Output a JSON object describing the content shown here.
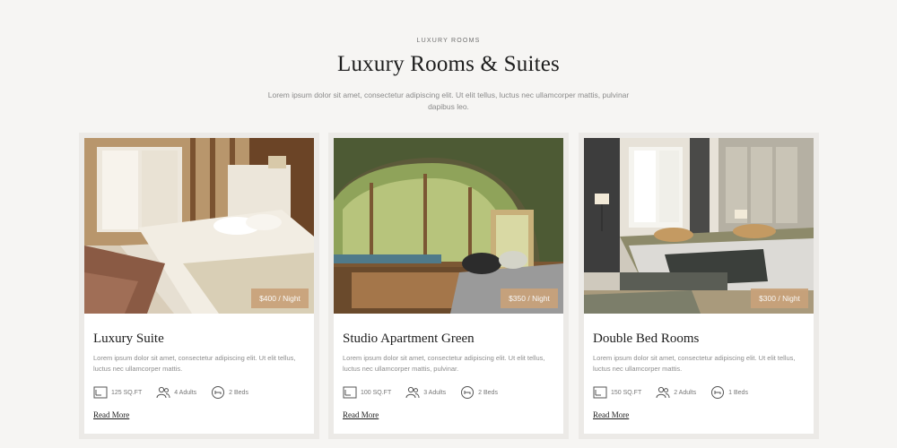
{
  "section": {
    "eyebrow": "LUXURY ROOMS",
    "title": "Luxury Rooms & Suites",
    "intro": "Lorem ipsum dolor sit amet, consectetur adipiscing elit. Ut elit tellus, luctus nec ullamcorper mattis, pulvinar dapibus leo."
  },
  "rooms": [
    {
      "title": "Luxury Suite",
      "price": "$400 / Night",
      "description": "Lorem ipsum dolor sit amet, consectetur adipiscing elit. Ut elit tellus, luctus nec ullamcorper mattis.",
      "size": "125 SQ.FT",
      "guests": "4 Adults",
      "beds": "2 Beds",
      "read_more": "Read More"
    },
    {
      "title": "Studio Apartment Green",
      "price": "$350 / Night",
      "description": "Lorem ipsum dolor sit amet, consectetur adipiscing elit. Ut elit tellus, luctus nec ullamcorper mattis, pulvinar.",
      "size": "100 SQ.FT",
      "guests": "3 Adults",
      "beds": "2 Beds",
      "read_more": "Read More"
    },
    {
      "title": "Double Bed Rooms",
      "price": "$300 / Night",
      "description": "Lorem ipsum dolor sit amet, consectetur adipiscing elit. Ut elit tellus, luctus nec ullamcorper mattis.",
      "size": "150 SQ.FT",
      "guests": "2 Adults",
      "beds": "1 Beds",
      "read_more": "Read More"
    }
  ],
  "icons": [
    "area-icon",
    "guests-icon",
    "beds-icon"
  ],
  "colors": {
    "accent": "#c9a27a",
    "background": "#f6f5f3",
    "card_frame": "#eceae7"
  }
}
